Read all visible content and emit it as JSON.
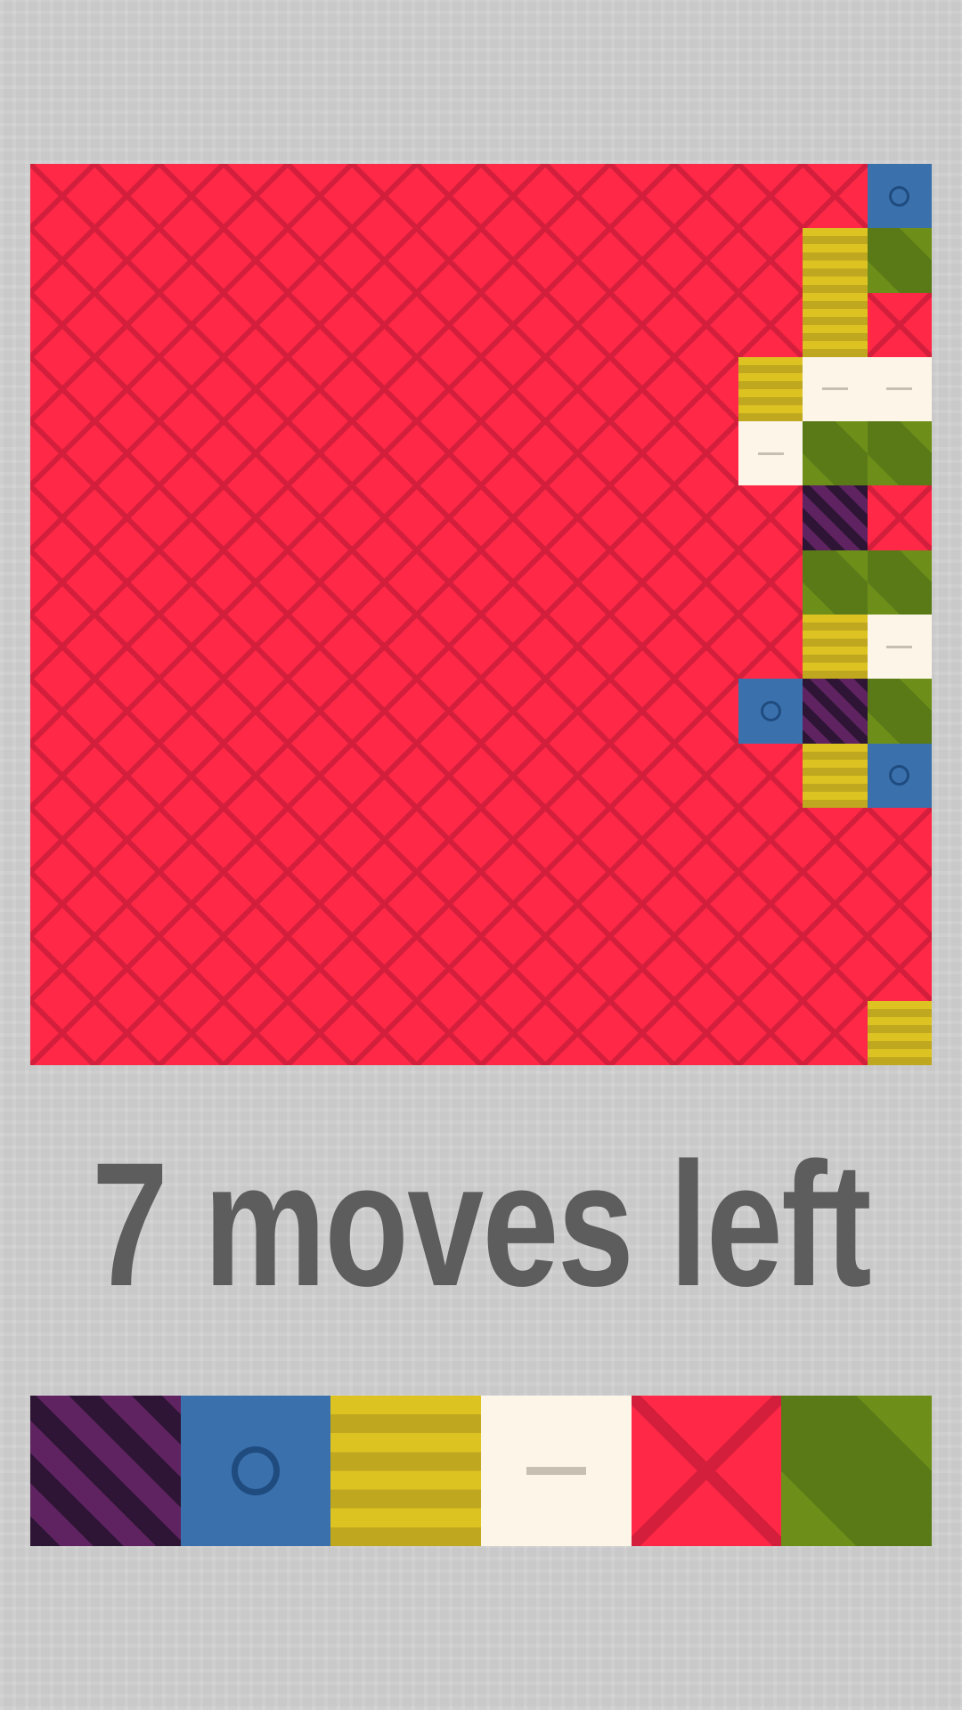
{
  "moves_label": "7 moves left",
  "colors": {
    "red": "#ff2847",
    "blue": "#3a71ad",
    "yellow": "#ddc321",
    "cream": "#fdf6e8",
    "green": "#6d8f1a",
    "purple": "#5e2360",
    "text": "#5d5d5d",
    "background": "#c9c9c9"
  },
  "board": {
    "size": 14,
    "rows": [
      [
        "R",
        "R",
        "R",
        "R",
        "R",
        "R",
        "R",
        "R",
        "R",
        "R",
        "R",
        "R",
        "R",
        "B"
      ],
      [
        "R",
        "R",
        "R",
        "R",
        "R",
        "R",
        "R",
        "R",
        "R",
        "R",
        "R",
        "R",
        "Y",
        "G"
      ],
      [
        "R",
        "R",
        "R",
        "R",
        "R",
        "R",
        "R",
        "R",
        "R",
        "R",
        "R",
        "R",
        "Y",
        "R"
      ],
      [
        "R",
        "R",
        "R",
        "R",
        "R",
        "R",
        "R",
        "R",
        "R",
        "R",
        "R",
        "Y",
        "C",
        "C"
      ],
      [
        "R",
        "R",
        "R",
        "R",
        "R",
        "R",
        "R",
        "R",
        "R",
        "R",
        "R",
        "C",
        "G",
        "G"
      ],
      [
        "R",
        "R",
        "R",
        "R",
        "R",
        "R",
        "R",
        "R",
        "R",
        "R",
        "R",
        "R",
        "P",
        "R"
      ],
      [
        "R",
        "R",
        "R",
        "R",
        "R",
        "R",
        "R",
        "R",
        "R",
        "R",
        "R",
        "R",
        "G",
        "G"
      ],
      [
        "R",
        "R",
        "R",
        "R",
        "R",
        "R",
        "R",
        "R",
        "R",
        "R",
        "R",
        "R",
        "Y",
        "C"
      ],
      [
        "R",
        "R",
        "R",
        "R",
        "R",
        "R",
        "R",
        "R",
        "R",
        "R",
        "R",
        "B",
        "P",
        "G"
      ],
      [
        "R",
        "R",
        "R",
        "R",
        "R",
        "R",
        "R",
        "R",
        "R",
        "R",
        "R",
        "R",
        "Y",
        "B"
      ],
      [
        "R",
        "R",
        "R",
        "R",
        "R",
        "R",
        "R",
        "R",
        "R",
        "R",
        "R",
        "R",
        "R",
        "R"
      ],
      [
        "R",
        "R",
        "R",
        "R",
        "R",
        "R",
        "R",
        "R",
        "R",
        "R",
        "R",
        "R",
        "R",
        "R"
      ],
      [
        "R",
        "R",
        "R",
        "R",
        "R",
        "R",
        "R",
        "R",
        "R",
        "R",
        "R",
        "R",
        "R",
        "R"
      ],
      [
        "R",
        "R",
        "R",
        "R",
        "R",
        "R",
        "R",
        "R",
        "R",
        "R",
        "R",
        "R",
        "R",
        "Y"
      ]
    ]
  },
  "palette": [
    {
      "color": "purple"
    },
    {
      "color": "blue"
    },
    {
      "color": "yellow"
    },
    {
      "color": "cream"
    },
    {
      "color": "red"
    },
    {
      "color": "green"
    }
  ]
}
